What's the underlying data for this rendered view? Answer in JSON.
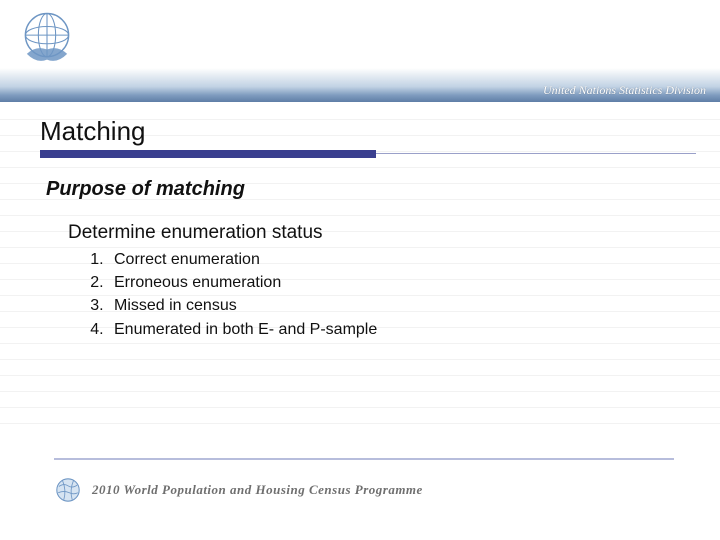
{
  "header": {
    "org_text": "United Nations Statistics Division"
  },
  "title": "Matching",
  "subtitle": "Purpose of matching",
  "section_heading": "Determine enumeration status",
  "items": [
    "Correct enumeration",
    "Erroneous enumeration",
    "Missed in census",
    "Enumerated in both E- and P-sample"
  ],
  "footer": {
    "programme_text": "2010 World Population and Housing Census Programme"
  },
  "icons": {
    "un_emblem": "un-emblem-icon",
    "footer_globe": "globe-icon"
  },
  "colors": {
    "accent": "#3a3f8f",
    "footer_rule": "#b7bddc"
  }
}
